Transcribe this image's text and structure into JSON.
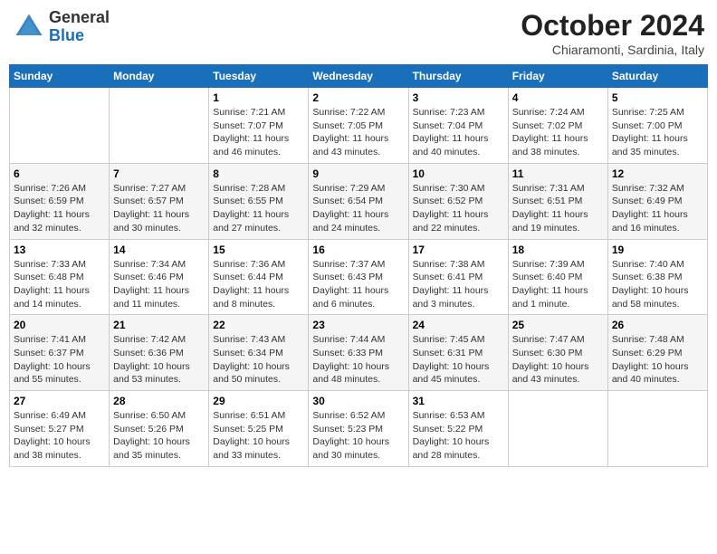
{
  "header": {
    "logo_general": "General",
    "logo_blue": "Blue",
    "month_title": "October 2024",
    "location": "Chiaramonti, Sardinia, Italy"
  },
  "weekdays": [
    "Sunday",
    "Monday",
    "Tuesday",
    "Wednesday",
    "Thursday",
    "Friday",
    "Saturday"
  ],
  "weeks": [
    [
      {
        "day": "",
        "info": ""
      },
      {
        "day": "",
        "info": ""
      },
      {
        "day": "1",
        "info": "Sunrise: 7:21 AM\nSunset: 7:07 PM\nDaylight: 11 hours and 46 minutes."
      },
      {
        "day": "2",
        "info": "Sunrise: 7:22 AM\nSunset: 7:05 PM\nDaylight: 11 hours and 43 minutes."
      },
      {
        "day": "3",
        "info": "Sunrise: 7:23 AM\nSunset: 7:04 PM\nDaylight: 11 hours and 40 minutes."
      },
      {
        "day": "4",
        "info": "Sunrise: 7:24 AM\nSunset: 7:02 PM\nDaylight: 11 hours and 38 minutes."
      },
      {
        "day": "5",
        "info": "Sunrise: 7:25 AM\nSunset: 7:00 PM\nDaylight: 11 hours and 35 minutes."
      }
    ],
    [
      {
        "day": "6",
        "info": "Sunrise: 7:26 AM\nSunset: 6:59 PM\nDaylight: 11 hours and 32 minutes."
      },
      {
        "day": "7",
        "info": "Sunrise: 7:27 AM\nSunset: 6:57 PM\nDaylight: 11 hours and 30 minutes."
      },
      {
        "day": "8",
        "info": "Sunrise: 7:28 AM\nSunset: 6:55 PM\nDaylight: 11 hours and 27 minutes."
      },
      {
        "day": "9",
        "info": "Sunrise: 7:29 AM\nSunset: 6:54 PM\nDaylight: 11 hours and 24 minutes."
      },
      {
        "day": "10",
        "info": "Sunrise: 7:30 AM\nSunset: 6:52 PM\nDaylight: 11 hours and 22 minutes."
      },
      {
        "day": "11",
        "info": "Sunrise: 7:31 AM\nSunset: 6:51 PM\nDaylight: 11 hours and 19 minutes."
      },
      {
        "day": "12",
        "info": "Sunrise: 7:32 AM\nSunset: 6:49 PM\nDaylight: 11 hours and 16 minutes."
      }
    ],
    [
      {
        "day": "13",
        "info": "Sunrise: 7:33 AM\nSunset: 6:48 PM\nDaylight: 11 hours and 14 minutes."
      },
      {
        "day": "14",
        "info": "Sunrise: 7:34 AM\nSunset: 6:46 PM\nDaylight: 11 hours and 11 minutes."
      },
      {
        "day": "15",
        "info": "Sunrise: 7:36 AM\nSunset: 6:44 PM\nDaylight: 11 hours and 8 minutes."
      },
      {
        "day": "16",
        "info": "Sunrise: 7:37 AM\nSunset: 6:43 PM\nDaylight: 11 hours and 6 minutes."
      },
      {
        "day": "17",
        "info": "Sunrise: 7:38 AM\nSunset: 6:41 PM\nDaylight: 11 hours and 3 minutes."
      },
      {
        "day": "18",
        "info": "Sunrise: 7:39 AM\nSunset: 6:40 PM\nDaylight: 11 hours and 1 minute."
      },
      {
        "day": "19",
        "info": "Sunrise: 7:40 AM\nSunset: 6:38 PM\nDaylight: 10 hours and 58 minutes."
      }
    ],
    [
      {
        "day": "20",
        "info": "Sunrise: 7:41 AM\nSunset: 6:37 PM\nDaylight: 10 hours and 55 minutes."
      },
      {
        "day": "21",
        "info": "Sunrise: 7:42 AM\nSunset: 6:36 PM\nDaylight: 10 hours and 53 minutes."
      },
      {
        "day": "22",
        "info": "Sunrise: 7:43 AM\nSunset: 6:34 PM\nDaylight: 10 hours and 50 minutes."
      },
      {
        "day": "23",
        "info": "Sunrise: 7:44 AM\nSunset: 6:33 PM\nDaylight: 10 hours and 48 minutes."
      },
      {
        "day": "24",
        "info": "Sunrise: 7:45 AM\nSunset: 6:31 PM\nDaylight: 10 hours and 45 minutes."
      },
      {
        "day": "25",
        "info": "Sunrise: 7:47 AM\nSunset: 6:30 PM\nDaylight: 10 hours and 43 minutes."
      },
      {
        "day": "26",
        "info": "Sunrise: 7:48 AM\nSunset: 6:29 PM\nDaylight: 10 hours and 40 minutes."
      }
    ],
    [
      {
        "day": "27",
        "info": "Sunrise: 6:49 AM\nSunset: 5:27 PM\nDaylight: 10 hours and 38 minutes."
      },
      {
        "day": "28",
        "info": "Sunrise: 6:50 AM\nSunset: 5:26 PM\nDaylight: 10 hours and 35 minutes."
      },
      {
        "day": "29",
        "info": "Sunrise: 6:51 AM\nSunset: 5:25 PM\nDaylight: 10 hours and 33 minutes."
      },
      {
        "day": "30",
        "info": "Sunrise: 6:52 AM\nSunset: 5:23 PM\nDaylight: 10 hours and 30 minutes."
      },
      {
        "day": "31",
        "info": "Sunrise: 6:53 AM\nSunset: 5:22 PM\nDaylight: 10 hours and 28 minutes."
      },
      {
        "day": "",
        "info": ""
      },
      {
        "day": "",
        "info": ""
      }
    ]
  ]
}
